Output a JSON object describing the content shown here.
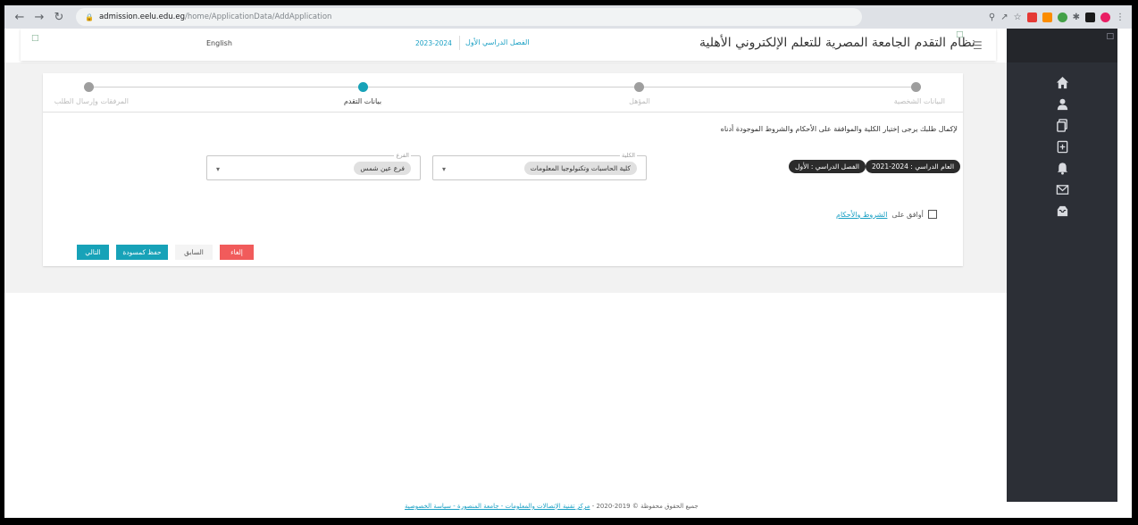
{
  "browser": {
    "url_host": "admission.eelu.edu.eg",
    "url_path": "/home/ApplicationData/AddApplication"
  },
  "header": {
    "language_toggle": "English",
    "academic_year": "2023-2024",
    "semester": "الفصل الدراسي الأول",
    "title": "نظام التقدم الجامعة المصرية للتعلم الإلكتروني الأهلية"
  },
  "stepper": {
    "steps": [
      {
        "label": "البيانات الشخصية",
        "active": false
      },
      {
        "label": "المؤهل",
        "active": false
      },
      {
        "label": "بيانات التقدم",
        "active": true
      },
      {
        "label": "المرفقات وإرسال الطلب",
        "active": false
      }
    ]
  },
  "form": {
    "instruction": "لإكمال طلبك يرجى إختيار الكلية والموافقة على الأحكام والشروط الموجودة أدناه",
    "academic_year_chip": "العام الدراسي : 2024-2021",
    "semester_chip": "الفصل الدراسي : الأول",
    "faculty_label": "الكلية",
    "faculty_value": "كلية الحاسبات وتكنولوجيا المعلومات",
    "branch_label": "الفرع",
    "branch_value": "فرع عين شمس",
    "agree_text": "أوافق على",
    "terms_link": "الشروط والأحكام"
  },
  "buttons": {
    "next": "التالي",
    "save_draft": "حفظ كمسودة",
    "previous": "السابق",
    "cancel": "إلغاء"
  },
  "footer": {
    "copyright": "جميع الحقوق محفوظة © 2019-2020 -",
    "link": "مركز تقنية الإتصالات والمعلومات - جامعة المنصورة - سياسة الخصوصية"
  },
  "colors": {
    "accent": "#17a2b8",
    "danger": "#f15b5b",
    "sidebar": "#2c2f36"
  }
}
